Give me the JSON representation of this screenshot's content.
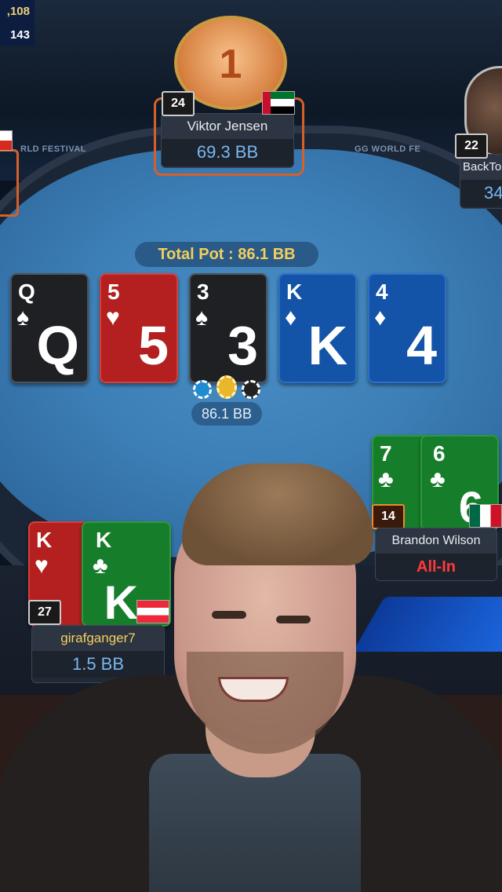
{
  "hud": {
    "value_top": ",108",
    "value_bottom": "143"
  },
  "table_brand": {
    "left": "RLD FESTIVAL",
    "right": "GG WORLD FE"
  },
  "players": [
    {
      "id": "top",
      "name": "Viktor Jensen",
      "stack": "69.3 BB",
      "level": "24",
      "rank_badge": "1",
      "flag": "uae"
    },
    {
      "id": "right-top",
      "name": "BackTo",
      "stack": "34",
      "level": "22"
    },
    {
      "id": "right",
      "name": "Brandon Wilson",
      "status": "All-In",
      "level": "14",
      "flag": "mexico",
      "cards": [
        {
          "rank": "7",
          "suit": "♣",
          "color": "green"
        },
        {
          "rank": "6",
          "suit": "♣",
          "color": "green"
        }
      ]
    },
    {
      "id": "hero",
      "name": "girafganger7",
      "stack": "1.5 BB",
      "level": "27",
      "flag": "austria",
      "cards": [
        {
          "rank": "K",
          "suit": "♥",
          "color": "red"
        },
        {
          "rank": "K",
          "suit": "♣",
          "color": "green"
        }
      ]
    }
  ],
  "pot": {
    "label": "Total Pot : 86.1 BB",
    "amount": "86.1 BB"
  },
  "board": [
    {
      "rank": "Q",
      "suit": "♠",
      "color": "black"
    },
    {
      "rank": "5",
      "suit": "♥",
      "color": "red"
    },
    {
      "rank": "3",
      "suit": "♠",
      "color": "black"
    },
    {
      "rank": "K",
      "suit": "♦",
      "color": "blue"
    },
    {
      "rank": "4",
      "suit": "♦",
      "color": "blue"
    }
  ],
  "colors": {
    "felt": "#3c7eb6",
    "pot_text": "#f3cf5c",
    "stack_text": "#79b7ee",
    "allin": "#ff3a3a"
  }
}
